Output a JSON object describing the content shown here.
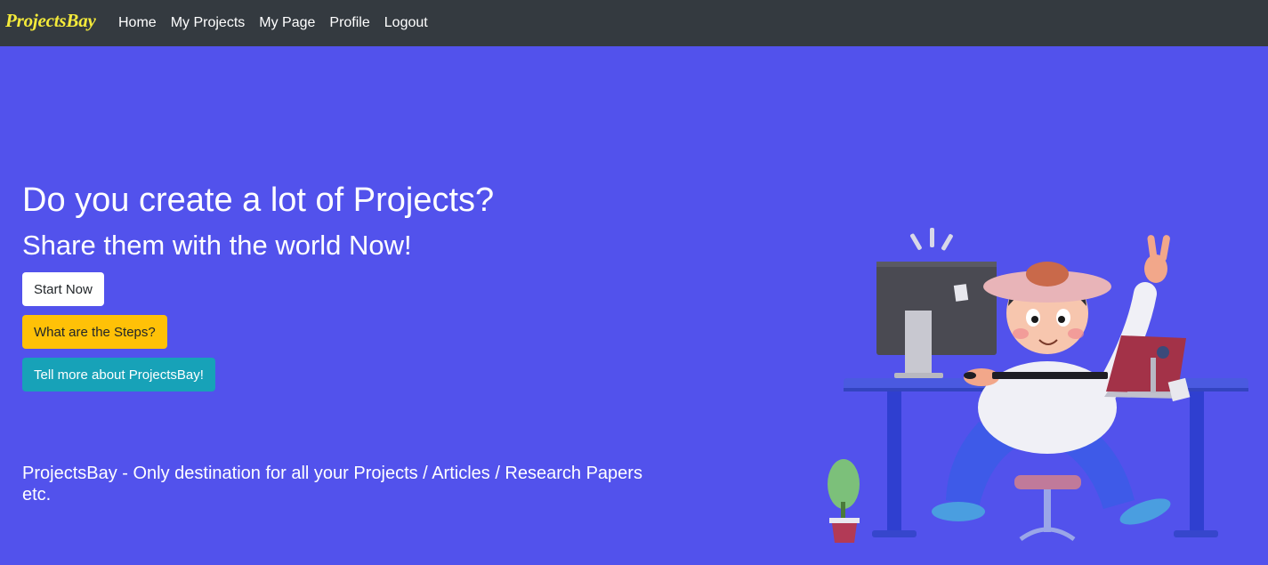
{
  "navbar": {
    "brand": "ProjectsBay",
    "links": [
      "Home",
      "My Projects",
      "My Page",
      "Profile",
      "Logout"
    ]
  },
  "hero": {
    "headline": "Do you create a lot of Projects?",
    "subheadline": "Share them with the world Now!",
    "buttons": {
      "start": "Start Now",
      "steps": "What are the Steps?",
      "more": "Tell more about ProjectsBay!"
    },
    "tagline": "ProjectsBay - Only destination for all your Projects / Articles / Research Papers etc."
  },
  "illustration": {
    "icon": "person-at-desk-illustration"
  },
  "colors": {
    "hero_bg": "#5252ec",
    "navbar_bg": "#343a40",
    "brand": "#f4ea3a",
    "steps_button": "#ffc107",
    "more_button": "#17a2b8"
  }
}
